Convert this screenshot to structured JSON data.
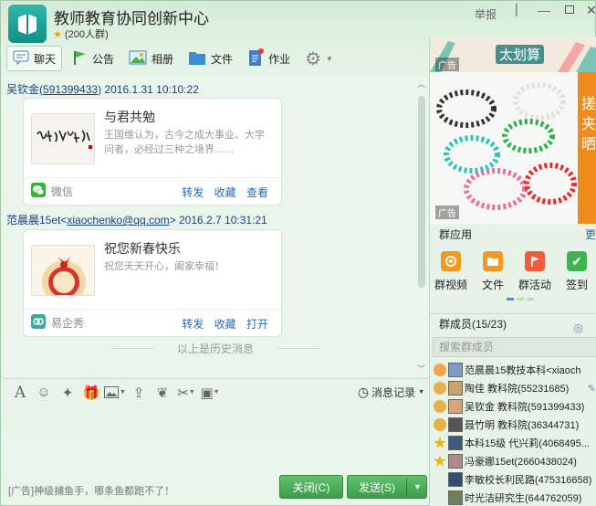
{
  "header": {
    "title": "教师教育协同创新中心",
    "subtitle": "(200人群)",
    "report_label": "举报"
  },
  "toolbar": {
    "tabs": [
      "聊天",
      "公告",
      "相册",
      "文件",
      "作业"
    ]
  },
  "messages": [
    {
      "sender_name": "吴钦金",
      "sender_id": "591399433",
      "time": "2016.1.31 10:10:22",
      "card": {
        "title": "与君共勉",
        "desc": "王国维认为，古今之成大事业、大学问者，必经过三种之境界……",
        "source": "微信",
        "actions": [
          "转发",
          "收藏",
          "查看"
        ]
      }
    },
    {
      "sender_name": "范晨晨15et",
      "sender_id": "xiaochenko@qq.com",
      "time": "2016.2.7 10:31:21",
      "card": {
        "title": "祝您新春快乐",
        "desc": "祝您天天开心，阖家幸福！",
        "source": "易企秀",
        "actions": [
          "转发",
          "收藏",
          "打开"
        ]
      }
    }
  ],
  "history_divider": "以上是历史消息",
  "input_toolbar": {
    "history_label": "消息记录"
  },
  "footer": {
    "ad_text": "[广告]神级捕鱼手，哪条鱼都跑不了！",
    "close_label": "关闭(C)",
    "send_label": "发送(S)"
  },
  "right_panel": {
    "banner_title": "太划算",
    "ad_tag": "广告",
    "group_apps_title": "群应用",
    "more_label": "更",
    "apps": [
      "群视频",
      "文件",
      "群活动",
      "签到"
    ],
    "members_title": "群成员(15/23)",
    "search_placeholder": "搜索群成员",
    "members": [
      "范晨晨15教技本科<xiaoch",
      "陶佳 教科院(55231685)",
      "吴钦金 教科院(591399433)",
      "聂竹明 教科院(36344731)",
      "本科15级 代兴莉(4068495...",
      "冯豪娜15et(2660438024)",
      "李敏校长利民路(475316658)",
      "时光洁研究生(644762059)"
    ]
  },
  "colors": {
    "accent_green": "#3b9d49",
    "link_blue": "#2a6bb5",
    "sender_blue": "#1a3f86"
  }
}
